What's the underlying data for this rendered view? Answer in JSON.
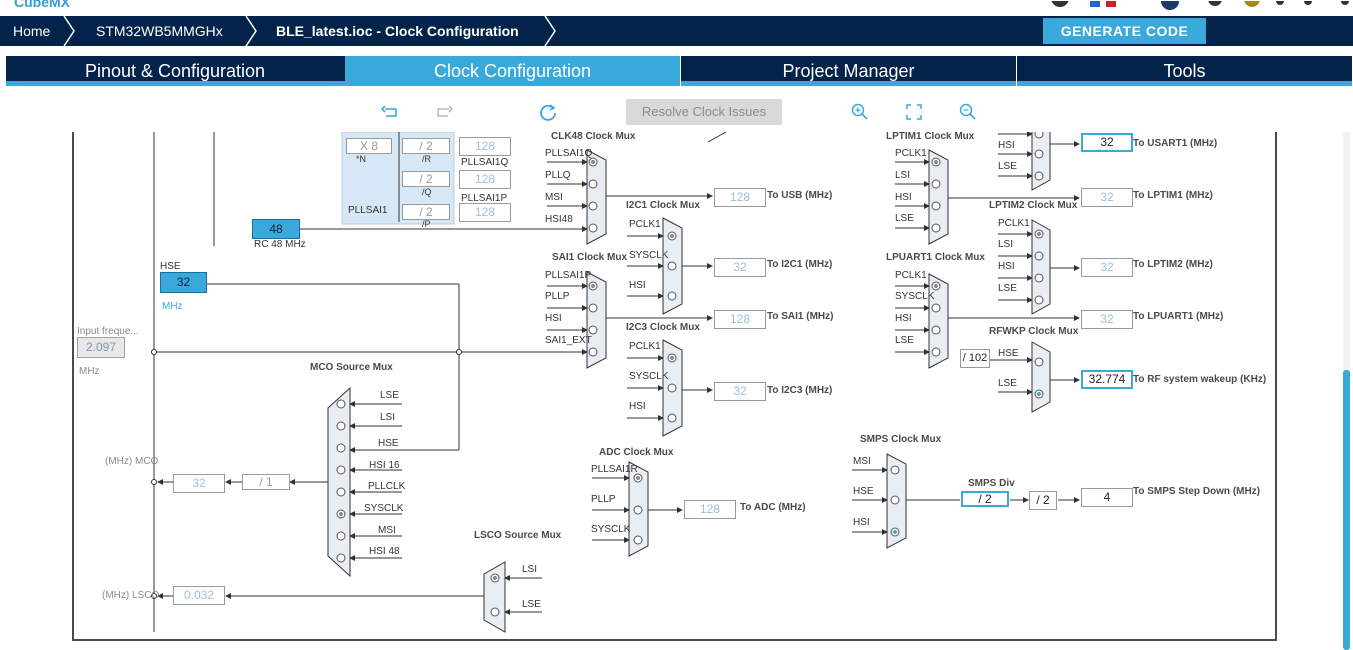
{
  "app": {
    "logo": "CubeMX"
  },
  "breadcrumb": {
    "home": "Home",
    "device": "STM32WB5MMGHx",
    "file": "BLE_latest.ioc - Clock Configuration"
  },
  "generate_label": "GENERATE CODE",
  "tabs": [
    {
      "label": "Pinout & Configuration"
    },
    {
      "label": "Clock Configuration"
    },
    {
      "label": "Project Manager"
    },
    {
      "label": "Tools"
    }
  ],
  "toolbar": {
    "resolve_label": "Resolve Clock Issues",
    "icons": [
      "undo-icon",
      "redo-icon",
      "reset-icon",
      "zoom-in-icon",
      "fit-icon",
      "zoom-out-icon"
    ]
  },
  "colors": {
    "navy": "#03234b",
    "accent": "#39a9dc"
  },
  "diagram": {
    "pllsai1": {
      "mult": "X 8",
      "n_label": "*N",
      "r_div": "/ 2",
      "r_label": "/R",
      "q_div": "/ 2",
      "q_label": "/Q",
      "p_div": "/ 2",
      "p_label": "/P",
      "name": "PLLSAI1",
      "r_out": "128",
      "q_out": "128",
      "p_out": "128",
      "q_name": "PLLSAI1Q",
      "p_name": "PLLSAI1P"
    },
    "rc48": {
      "value": "48",
      "label": "RC 48 MHz"
    },
    "hse": {
      "label": "HSE",
      "value": "32",
      "unit": "MHz"
    },
    "input_freq": {
      "label": "Input freque...",
      "value": "2.097",
      "unit": "MHz"
    },
    "clk48_mux": {
      "title": "CLK48 Clock Mux",
      "inputs": [
        "PLLSAI1Q",
        "PLLQ",
        "MSI",
        "HSI48"
      ],
      "out": "128",
      "out_label": "To USB (MHz)"
    },
    "i2c1_mux": {
      "title": "I2C1 Clock Mux",
      "inputs": [
        "PCLK1",
        "SYSCLK",
        "HSI"
      ],
      "out": "32",
      "out_label": "To I2C1 (MHz)"
    },
    "sai1_mux": {
      "title": "SAI1 Clock Mux",
      "inputs": [
        "PLLSAI1P",
        "PLLP",
        "HSI",
        "SAI1_EXT"
      ],
      "out": "128",
      "out_label": "To SAI1 (MHz)"
    },
    "i2c3_mux": {
      "title": "I2C3 Clock Mux",
      "inputs": [
        "PCLK1",
        "SYSCLK",
        "HSI"
      ],
      "out": "32",
      "out_label": "To I2C3 (MHz)"
    },
    "adc_mux": {
      "title": "ADC Clock Mux",
      "inputs": [
        "PLLSAI1R",
        "PLLP",
        "SYSCLK"
      ],
      "out": "128",
      "out_label": "To ADC (MHz)"
    },
    "mco_mux": {
      "title": "MCO Source Mux",
      "inputs": [
        "LSE",
        "LSI",
        "HSE",
        "HSI 16",
        "PLLCLK",
        "SYSCLK",
        "MSI",
        "HSI 48"
      ],
      "out_label": "(MHz) MCO",
      "out": "32",
      "div": "/ 1"
    },
    "lsco_mux": {
      "title": "LSCO Source Mux",
      "inputs": [
        "LSI",
        "LSE"
      ],
      "out_label": "(MHz) LSCO",
      "out": "0.032"
    },
    "usart1": {
      "inputs": [
        "HSI",
        "LSE"
      ],
      "out": "32",
      "out_label": "To USART1 (MHz)"
    },
    "lptim1_mux": {
      "title": "LPTIM1 Clock Mux",
      "inputs": [
        "PCLK1",
        "LSI",
        "HSI",
        "LSE"
      ],
      "out": "32",
      "out_label": "To LPTIM1 (MHz)"
    },
    "lptim2_mux": {
      "title": "LPTIM2 Clock Mux",
      "inputs": [
        "PCLK1",
        "LSI",
        "HSI",
        "LSE"
      ],
      "out": "32",
      "out_label": "To LPTIM2 (MHz)"
    },
    "lpuart1_mux": {
      "title": "LPUART1 Clock Mux",
      "inputs": [
        "PCLK1",
        "SYSCLK",
        "HSI",
        "LSE"
      ],
      "out": "32",
      "out_label": "To LPUART1 (MHz)"
    },
    "rfwkp_mux": {
      "title": "RFWKP Clock Mux",
      "div": "/ 102",
      "inputs": [
        "HSE",
        "LSE"
      ],
      "out": "32.774",
      "out_label": "To RF system wakeup (KHz)"
    },
    "smps_mux": {
      "title": "SMPS Clock Mux",
      "inputs": [
        "MSI",
        "HSE",
        "HSI"
      ],
      "div_title": "SMPS Div",
      "div": "/ 2",
      "div2": "/ 2",
      "out": "4",
      "out_label": "To SMPS Step Down (MHz)"
    }
  }
}
